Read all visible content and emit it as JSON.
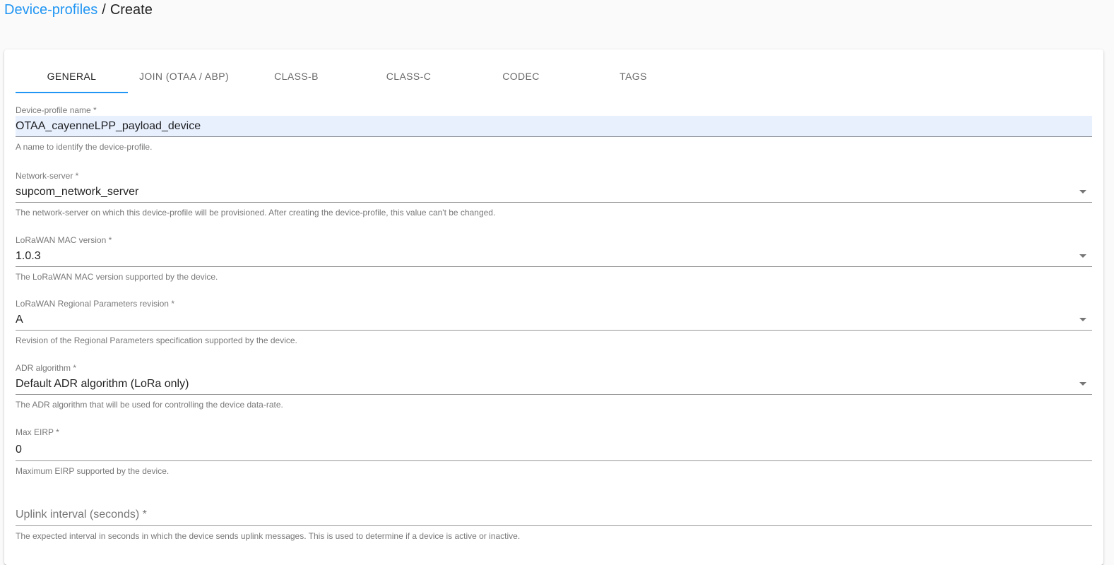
{
  "breadcrumb": {
    "parent": "Device-profiles",
    "separator": "/",
    "current": "Create"
  },
  "tabs": [
    {
      "label": "GENERAL",
      "active": true
    },
    {
      "label": "JOIN (OTAA / ABP)",
      "active": false
    },
    {
      "label": "CLASS-B",
      "active": false
    },
    {
      "label": "CLASS-C",
      "active": false
    },
    {
      "label": "CODEC",
      "active": false
    },
    {
      "label": "TAGS",
      "active": false
    }
  ],
  "form": {
    "name": {
      "label": "Device-profile name *",
      "value": "OTAA_cayenneLPP_payload_device",
      "helper": "A name to identify the device-profile."
    },
    "network_server": {
      "label": "Network-server *",
      "value": "supcom_network_server",
      "helper": "The network-server on which this device-profile will be provisioned. After creating the device-profile, this value can't be changed."
    },
    "mac_version": {
      "label": "LoRaWAN MAC version *",
      "value": "1.0.3",
      "helper": "The LoRaWAN MAC version supported by the device."
    },
    "regional_params": {
      "label": "LoRaWAN Regional Parameters revision *",
      "value": "A",
      "helper": "Revision of the Regional Parameters specification supported by the device."
    },
    "adr_algorithm": {
      "label": "ADR algorithm *",
      "value": "Default ADR algorithm (LoRa only)",
      "helper": "The ADR algorithm that will be used for controlling the device data-rate."
    },
    "max_eirp": {
      "label": "Max EIRP *",
      "value": "0",
      "helper": "Maximum EIRP supported by the device."
    },
    "uplink_interval": {
      "placeholder": "Uplink interval (seconds) *",
      "helper": "The expected interval in seconds in which the device sends uplink messages. This is used to determine if a device is active or inactive."
    }
  },
  "colors": {
    "accent": "#2196f3",
    "autofill": "#e8f0fe",
    "background": "#fafafa"
  }
}
